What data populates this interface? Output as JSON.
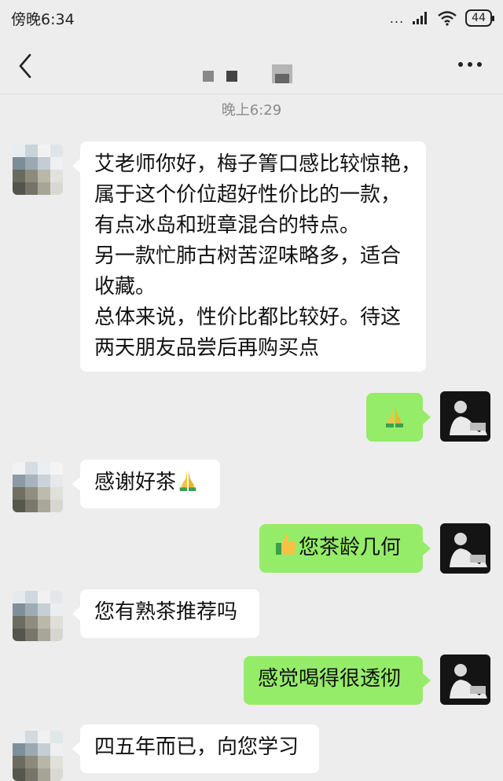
{
  "status_bar": {
    "time": "傍晚6:34",
    "signal_dots": "...",
    "battery": "44"
  },
  "chat": {
    "timestamp": "晚上6:29",
    "messages": [
      {
        "side": "left",
        "lines": [
          "艾老师你好，梅子箐口感比较惊艳，",
          "属于这个价位超好性价比的一款，",
          "有点冰岛和班章混合的特点。",
          "另一款忙肺古树苦涩味略多，适合",
          "收藏。",
          "总体来说，性价比都比较好。待这",
          "两天朋友品尝后再购买点"
        ]
      },
      {
        "side": "right",
        "emoji": "folded-hands"
      },
      {
        "side": "left",
        "text": "感谢好茶",
        "emoji": "folded-hands"
      },
      {
        "side": "right",
        "emoji": "thumbs-up",
        "text": "您茶龄几何"
      },
      {
        "side": "left",
        "text": "您有熟茶推荐吗"
      },
      {
        "side": "right",
        "text": "感觉喝得很透彻"
      },
      {
        "side": "left",
        "text": "四五年而已，向您学习"
      }
    ]
  },
  "colors": {
    "background": "#ededed",
    "bubble_incoming": "#ffffff",
    "bubble_outgoing": "#95ec69",
    "timestamp": "#8a8a8a"
  }
}
